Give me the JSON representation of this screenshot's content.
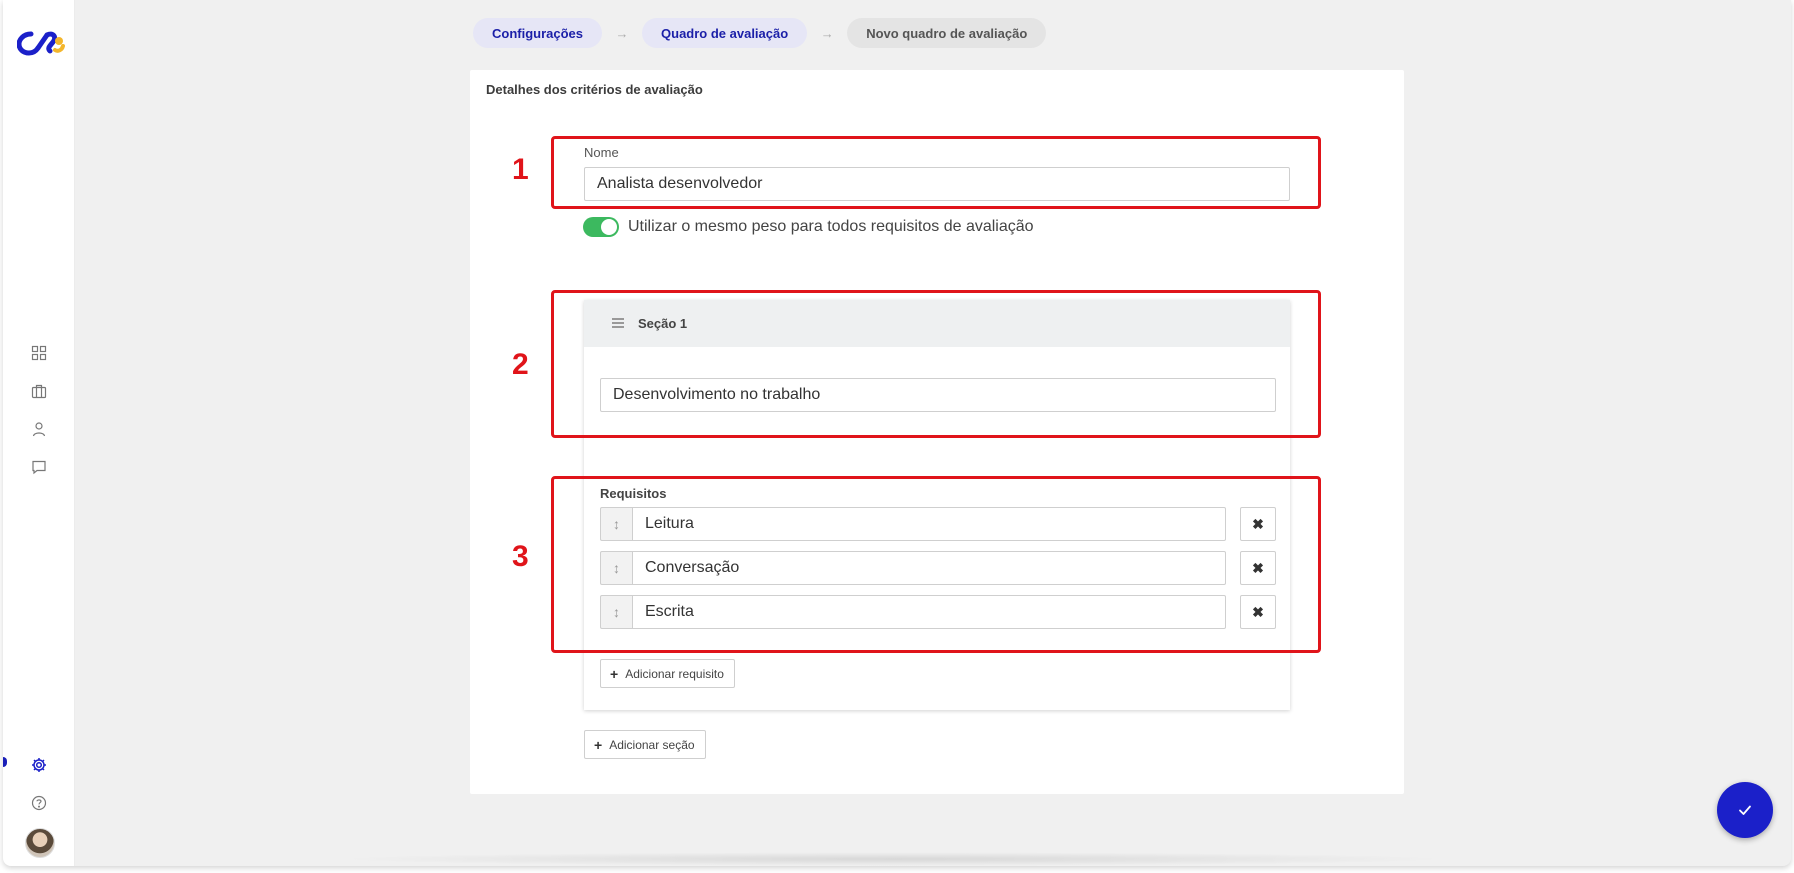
{
  "breadcrumb": {
    "items": [
      {
        "label": "Configurações"
      },
      {
        "label": "Quadro de avaliação"
      },
      {
        "label": "Novo quadro de avaliação"
      }
    ],
    "separator": "→"
  },
  "card": {
    "title": "Detalhes dos critérios de avaliação"
  },
  "name_field": {
    "label": "Nome",
    "value": "Analista desenvolvedor"
  },
  "same_weight_toggle": {
    "label": "Utilizar o mesmo peso para todos requisitos de avaliação",
    "checked": true
  },
  "section": {
    "title": "Seção 1",
    "name_value": "Desenvolvimento no trabalho",
    "requirements_label": "Requisitos",
    "requirements": [
      {
        "value": "Leitura"
      },
      {
        "value": "Conversação"
      },
      {
        "value": "Escrita"
      }
    ],
    "add_requirement_label": "Adicionar requisito"
  },
  "add_section_label": "Adicionar seção",
  "annotations": [
    "1",
    "2",
    "3"
  ],
  "sidebar": {
    "icons": [
      "dashboard-icon",
      "briefcase-icon",
      "user-icon",
      "chat-icon",
      "settings-icon",
      "help-icon"
    ]
  },
  "colors": {
    "accent": "#1b20c9",
    "toggle_on": "#3cb95f",
    "highlight": "#e0141a"
  }
}
